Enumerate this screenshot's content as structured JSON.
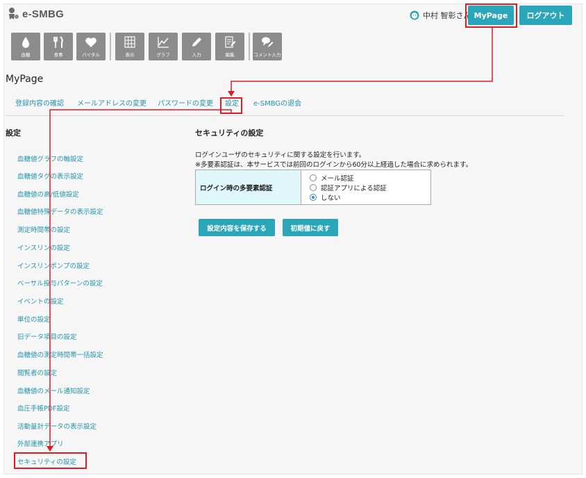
{
  "header": {
    "logo_text": "e-SMBG",
    "user_name": "中村 智彰さん",
    "mypage_label": "MyPage",
    "logout_label": "ログアウト"
  },
  "toolbar": {
    "items": [
      {
        "label": "血糖",
        "icon": "blood-drop-icon"
      },
      {
        "label": "食事",
        "icon": "meal-icon"
      },
      {
        "label": "バイタル",
        "icon": "heart-icon"
      },
      {
        "label": "表示",
        "icon": "grid-icon"
      },
      {
        "label": "グラフ",
        "icon": "graph-icon"
      },
      {
        "label": "入力",
        "icon": "pencil-icon"
      },
      {
        "label": "編集",
        "icon": "edit-document-icon"
      },
      {
        "label": "コメント入力",
        "icon": "comment-input-icon"
      }
    ]
  },
  "page": {
    "title": "MyPage"
  },
  "tabs": [
    {
      "label": "登録内容の確認"
    },
    {
      "label": "メールアドレスの変更"
    },
    {
      "label": "パスワードの変更"
    },
    {
      "label": "設定",
      "active": true
    },
    {
      "label": "e-SMBGの退会"
    }
  ],
  "sidebar": {
    "title": "設定",
    "items": [
      {
        "label": "血糖値グラフの軸設定"
      },
      {
        "label": "血糖値タグの表示設定"
      },
      {
        "label": "血糖値の高/低値設定"
      },
      {
        "label": "血糖値特殊データの表示設定"
      },
      {
        "label": "測定時間帯の設定"
      },
      {
        "label": "インスリンの設定"
      },
      {
        "label": "インスリンポンプの設定"
      },
      {
        "label": "ベーサル投与パターンの設定"
      },
      {
        "label": "イベントの設定"
      },
      {
        "label": "単位の設定"
      },
      {
        "label": "旧データ項目の設定"
      },
      {
        "label": "血糖値の測定時間帯一括設定"
      },
      {
        "label": "閲覧者の設定"
      },
      {
        "label": "血糖値のメール通知設定"
      },
      {
        "label": "血圧手帳PDF設定"
      },
      {
        "label": "活動量計データの表示設定"
      },
      {
        "label": "外部連携アプリ"
      },
      {
        "label": "セキュリティの設定",
        "active": true
      }
    ]
  },
  "main": {
    "section_title": "セキュリティの設定",
    "description_1": "ログインユーザのセキュリティに関する設定を行います。",
    "description_2": "※多要素認証は、本サービスでは前回のログインから60分以上経過した場合に求められます。",
    "mfa_label": "ログイン時の多要素認証",
    "options": [
      {
        "label": "メール認証",
        "checked": false
      },
      {
        "label": "認証アプリによる認証",
        "checked": false
      },
      {
        "label": "しない",
        "checked": true
      }
    ],
    "save_label": "設定内容を保存する",
    "reset_label": "初期値に戻す"
  },
  "colors": {
    "accent": "#2aa6b8",
    "link": "#2494ad",
    "highlight": "#e01b22",
    "toolbar": "#8c8c8c"
  }
}
